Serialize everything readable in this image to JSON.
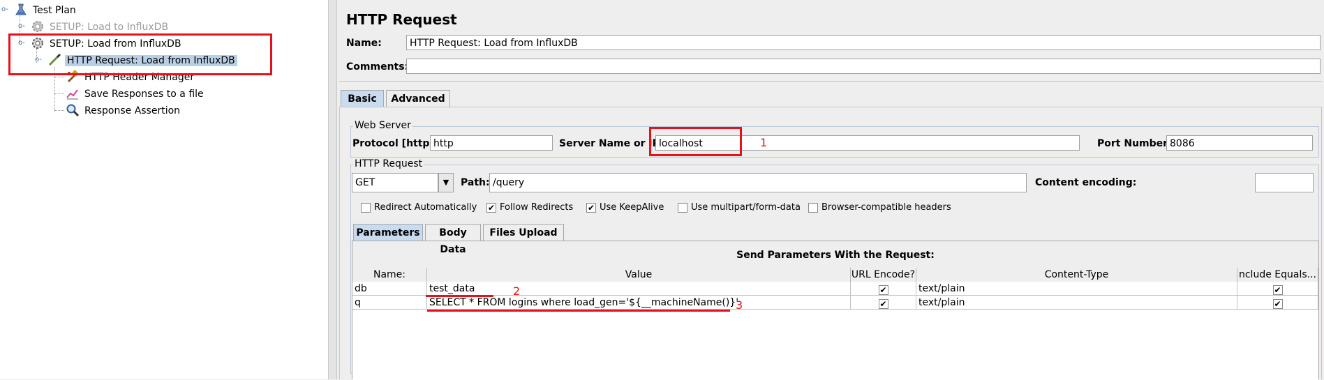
{
  "tree": {
    "items": [
      {
        "label": "Test Plan",
        "icon": "flask-icon"
      },
      {
        "label": "SETUP: Load to InfluxDB",
        "icon": "gear-icon",
        "state": "disabled"
      },
      {
        "label": "SETUP: Load from InfluxDB",
        "icon": "gear-icon"
      },
      {
        "label": "HTTP Request: Load from InfluxDB",
        "icon": "pipette-icon",
        "state": "selected"
      },
      {
        "label": "HTTP Header Manager",
        "icon": "hammer-icon"
      },
      {
        "label": "Save Responses to a file",
        "icon": "chart-icon"
      },
      {
        "label": "Response Assertion",
        "icon": "magnifier-icon"
      }
    ]
  },
  "panel": {
    "title": "HTTP Request",
    "name_label": "Name:",
    "name_value": "HTTP Request: Load from InfluxDB",
    "comments_label": "Comments:",
    "comments_value": "",
    "tabs": [
      {
        "label": "Basic",
        "active": true
      },
      {
        "label": "Advanced",
        "active": false
      }
    ]
  },
  "web_server": {
    "legend": "Web Server",
    "protocol_label": "Protocol [http]:",
    "protocol_value": "http",
    "server_label": "Server Name or IP:",
    "server_value": "localhost",
    "port_label": "Port Number:",
    "port_value": "8086"
  },
  "http_request": {
    "legend": "HTTP Request",
    "method": "GET",
    "path_label": "Path:",
    "path_value": "/query",
    "encoding_label": "Content encoding:",
    "encoding_value": "",
    "checkboxes": [
      {
        "label": "Redirect Automatically",
        "checked": false
      },
      {
        "label": "Follow Redirects",
        "checked": true
      },
      {
        "label": "Use KeepAlive",
        "checked": true
      },
      {
        "label": "Use multipart/form-data",
        "checked": false
      },
      {
        "label": "Browser-compatible headers",
        "checked": false
      }
    ]
  },
  "param_tabs": [
    {
      "label": "Parameters",
      "active": true
    },
    {
      "label": "Body Data",
      "active": false
    },
    {
      "label": "Files Upload",
      "active": false
    }
  ],
  "params": {
    "heading": "Send Parameters With the Request:",
    "columns": [
      "Name:",
      "Value",
      "URL Encode?",
      "Content-Type",
      "nclude Equals..."
    ],
    "rows": [
      {
        "name": "db",
        "value": "test_data",
        "url_encode": true,
        "content_type": "text/plain",
        "include_equals": true
      },
      {
        "name": "q",
        "value": "SELECT * FROM logins where load_gen='${__machineName()}'",
        "url_encode": true,
        "content_type": "text/plain",
        "include_equals": true
      }
    ]
  },
  "annotations": {
    "one": "1",
    "two": "2",
    "three": "3",
    "color": "#e8111b"
  },
  "check_glyph": "✔"
}
